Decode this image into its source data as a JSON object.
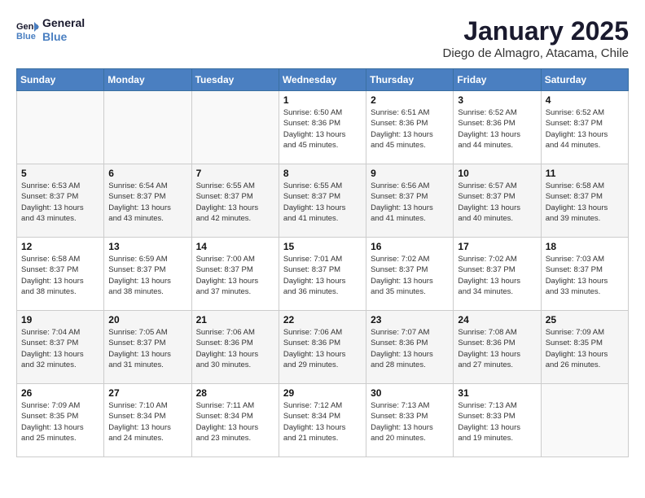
{
  "header": {
    "logo_line1": "General",
    "logo_line2": "Blue",
    "month_title": "January 2025",
    "location": "Diego de Almagro, Atacama, Chile"
  },
  "weekdays": [
    "Sunday",
    "Monday",
    "Tuesday",
    "Wednesday",
    "Thursday",
    "Friday",
    "Saturday"
  ],
  "weeks": [
    [
      {
        "day": "",
        "info": ""
      },
      {
        "day": "",
        "info": ""
      },
      {
        "day": "",
        "info": ""
      },
      {
        "day": "1",
        "info": "Sunrise: 6:50 AM\nSunset: 8:36 PM\nDaylight: 13 hours\nand 45 minutes."
      },
      {
        "day": "2",
        "info": "Sunrise: 6:51 AM\nSunset: 8:36 PM\nDaylight: 13 hours\nand 45 minutes."
      },
      {
        "day": "3",
        "info": "Sunrise: 6:52 AM\nSunset: 8:36 PM\nDaylight: 13 hours\nand 44 minutes."
      },
      {
        "day": "4",
        "info": "Sunrise: 6:52 AM\nSunset: 8:37 PM\nDaylight: 13 hours\nand 44 minutes."
      }
    ],
    [
      {
        "day": "5",
        "info": "Sunrise: 6:53 AM\nSunset: 8:37 PM\nDaylight: 13 hours\nand 43 minutes."
      },
      {
        "day": "6",
        "info": "Sunrise: 6:54 AM\nSunset: 8:37 PM\nDaylight: 13 hours\nand 43 minutes."
      },
      {
        "day": "7",
        "info": "Sunrise: 6:55 AM\nSunset: 8:37 PM\nDaylight: 13 hours\nand 42 minutes."
      },
      {
        "day": "8",
        "info": "Sunrise: 6:55 AM\nSunset: 8:37 PM\nDaylight: 13 hours\nand 41 minutes."
      },
      {
        "day": "9",
        "info": "Sunrise: 6:56 AM\nSunset: 8:37 PM\nDaylight: 13 hours\nand 41 minutes."
      },
      {
        "day": "10",
        "info": "Sunrise: 6:57 AM\nSunset: 8:37 PM\nDaylight: 13 hours\nand 40 minutes."
      },
      {
        "day": "11",
        "info": "Sunrise: 6:58 AM\nSunset: 8:37 PM\nDaylight: 13 hours\nand 39 minutes."
      }
    ],
    [
      {
        "day": "12",
        "info": "Sunrise: 6:58 AM\nSunset: 8:37 PM\nDaylight: 13 hours\nand 38 minutes."
      },
      {
        "day": "13",
        "info": "Sunrise: 6:59 AM\nSunset: 8:37 PM\nDaylight: 13 hours\nand 38 minutes."
      },
      {
        "day": "14",
        "info": "Sunrise: 7:00 AM\nSunset: 8:37 PM\nDaylight: 13 hours\nand 37 minutes."
      },
      {
        "day": "15",
        "info": "Sunrise: 7:01 AM\nSunset: 8:37 PM\nDaylight: 13 hours\nand 36 minutes."
      },
      {
        "day": "16",
        "info": "Sunrise: 7:02 AM\nSunset: 8:37 PM\nDaylight: 13 hours\nand 35 minutes."
      },
      {
        "day": "17",
        "info": "Sunrise: 7:02 AM\nSunset: 8:37 PM\nDaylight: 13 hours\nand 34 minutes."
      },
      {
        "day": "18",
        "info": "Sunrise: 7:03 AM\nSunset: 8:37 PM\nDaylight: 13 hours\nand 33 minutes."
      }
    ],
    [
      {
        "day": "19",
        "info": "Sunrise: 7:04 AM\nSunset: 8:37 PM\nDaylight: 13 hours\nand 32 minutes."
      },
      {
        "day": "20",
        "info": "Sunrise: 7:05 AM\nSunset: 8:37 PM\nDaylight: 13 hours\nand 31 minutes."
      },
      {
        "day": "21",
        "info": "Sunrise: 7:06 AM\nSunset: 8:36 PM\nDaylight: 13 hours\nand 30 minutes."
      },
      {
        "day": "22",
        "info": "Sunrise: 7:06 AM\nSunset: 8:36 PM\nDaylight: 13 hours\nand 29 minutes."
      },
      {
        "day": "23",
        "info": "Sunrise: 7:07 AM\nSunset: 8:36 PM\nDaylight: 13 hours\nand 28 minutes."
      },
      {
        "day": "24",
        "info": "Sunrise: 7:08 AM\nSunset: 8:36 PM\nDaylight: 13 hours\nand 27 minutes."
      },
      {
        "day": "25",
        "info": "Sunrise: 7:09 AM\nSunset: 8:35 PM\nDaylight: 13 hours\nand 26 minutes."
      }
    ],
    [
      {
        "day": "26",
        "info": "Sunrise: 7:09 AM\nSunset: 8:35 PM\nDaylight: 13 hours\nand 25 minutes."
      },
      {
        "day": "27",
        "info": "Sunrise: 7:10 AM\nSunset: 8:34 PM\nDaylight: 13 hours\nand 24 minutes."
      },
      {
        "day": "28",
        "info": "Sunrise: 7:11 AM\nSunset: 8:34 PM\nDaylight: 13 hours\nand 23 minutes."
      },
      {
        "day": "29",
        "info": "Sunrise: 7:12 AM\nSunset: 8:34 PM\nDaylight: 13 hours\nand 21 minutes."
      },
      {
        "day": "30",
        "info": "Sunrise: 7:13 AM\nSunset: 8:33 PM\nDaylight: 13 hours\nand 20 minutes."
      },
      {
        "day": "31",
        "info": "Sunrise: 7:13 AM\nSunset: 8:33 PM\nDaylight: 13 hours\nand 19 minutes."
      },
      {
        "day": "",
        "info": ""
      }
    ]
  ]
}
